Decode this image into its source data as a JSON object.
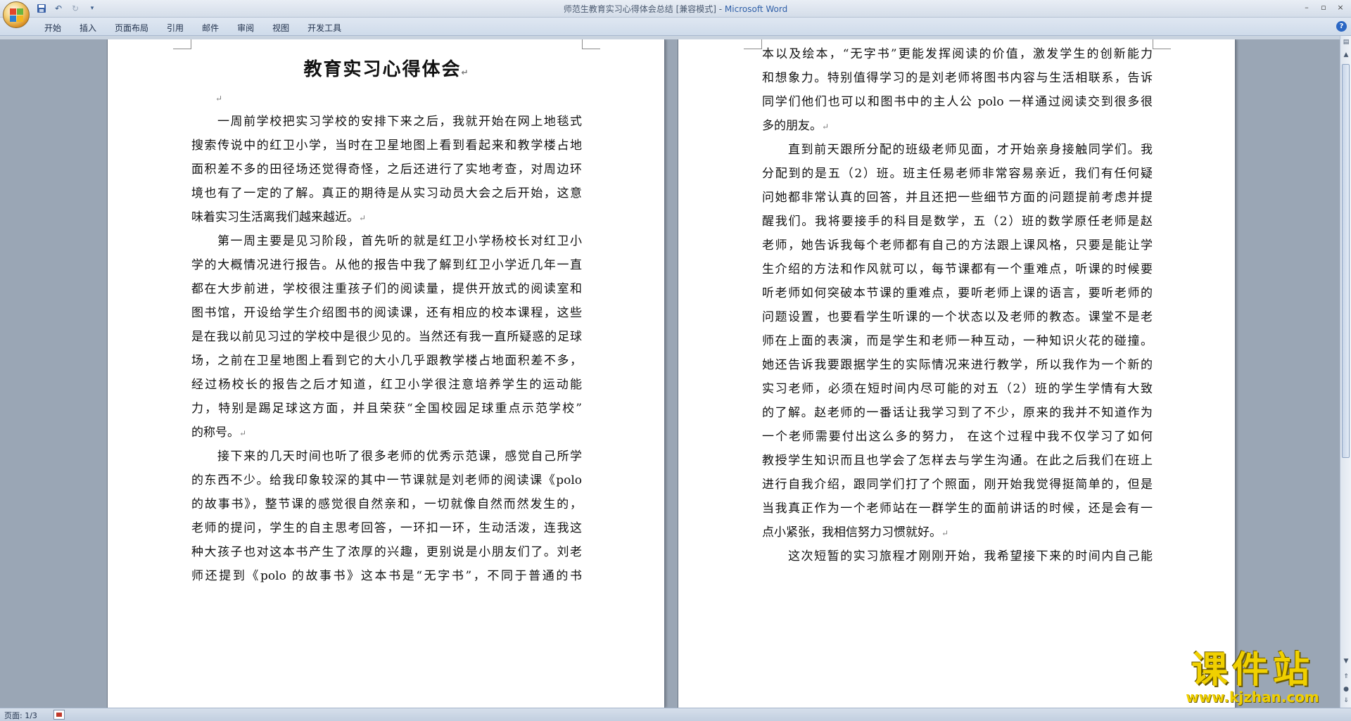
{
  "window": {
    "title": "师范生教育实习心得体会总结 [兼容模式] - ",
    "app_name": "Microsoft Word",
    "controls": [
      "–",
      "▫",
      "×"
    ]
  },
  "qat": {
    "save_icon": "save-icon",
    "undo_icon": "undo-icon",
    "redo_icon": "redo-icon",
    "customize_icon": "customize-icon"
  },
  "ribbon": {
    "tabs": [
      "开始",
      "插入",
      "页面布局",
      "引用",
      "邮件",
      "审阅",
      "视图",
      "开发工具"
    ]
  },
  "document": {
    "title": "教育实习心得体会",
    "para_mark": "↵",
    "page1_lines": [
      {
        "text": "一周前学校把实习学校的安排下来之后，我就开始在网上地毯式",
        "indent": true
      },
      {
        "text": "搜索传说中的红卫小学，当时在卫星地图上看到看起来和教学楼占地"
      },
      {
        "text": "面积差不多的田径场还觉得奇怪，之后还进行了实地考查，对周边环"
      },
      {
        "text": "境也有了一定的了解。真正的期待是从实习动员大会之后开始，这意"
      },
      {
        "text": "味着实习生活离我们越来越近。",
        "last": true
      },
      {
        "text": "第一周主要是见习阶段，首先听的就是红卫小学杨校长对红卫小",
        "indent": true
      },
      {
        "text": "学的大概情况进行报告。从他的报告中我了解到红卫小学近几年一直"
      },
      {
        "text": "都在大步前进，学校很注重孩子们的阅读量，提供开放式的阅读室和"
      },
      {
        "text": "图书馆，开设给学生介绍图书的阅读课，还有相应的校本课程，这些"
      },
      {
        "text": "是在我以前见习过的学校中是很少见的。当然还有我一直所疑惑的足球"
      },
      {
        "text": "场，之前在卫星地图上看到它的大小几乎跟教学楼占地面积差不多，"
      },
      {
        "text": "经过杨校长的报告之后才知道，红卫小学很注意培养学生的运动能"
      },
      {
        "text": "力，特别是踢足球这方面，并且荣获“全国校园足球重点示范学校”"
      },
      {
        "text": "的称号。",
        "last": true
      },
      {
        "text": "接下来的几天时间也听了很多老师的优秀示范课，感觉自己所学",
        "indent": true
      },
      {
        "text": "的东西不少。给我印象较深的其中一节课就是刘老师的阅读课《polo"
      },
      {
        "text": "的故事书》，整节课的感觉很自然亲和，一切就像自然而然发生的，"
      },
      {
        "text": "老师的提问，学生的自主思考回答，一环扣一环，生动活泼，连我这"
      },
      {
        "text": "种大孩子也对这本书产生了浓厚的兴趣，更别说是小朋友们了。刘老"
      },
      {
        "text": "师还提到《polo 的故事书》这本书是“无字书”，不同于普通的书"
      }
    ],
    "page2_lines": [
      {
        "text": "本以及绘本，“无字书”更能发挥阅读的价值，激发学生的创新能力"
      },
      {
        "text": "和想象力。特别值得学习的是刘老师将图书内容与生活相联系，告诉"
      },
      {
        "text": "同学们他们也可以和图书中的主人公 polo 一样通过阅读交到很多很"
      },
      {
        "text": "多的朋友。",
        "last": true
      },
      {
        "text": "直到前天跟所分配的班级老师见面，才开始亲身接触同学们。我",
        "indent": true
      },
      {
        "text": "分配到的是五（2）班。班主任易老师非常容易亲近，我们有任何疑"
      },
      {
        "text": "问她都非常认真的回答，并且还把一些细节方面的问题提前考虑并提"
      },
      {
        "text": "醒我们。我将要接手的科目是数学，五（2）班的数学原任老师是赵"
      },
      {
        "text": "老师，她告诉我每个老师都有自己的方法跟上课风格，只要是能让学"
      },
      {
        "text": "生介绍的方法和作风就可以，每节课都有一个重难点，听课的时候要"
      },
      {
        "text": "听老师如何突破本节课的重难点，要听老师上课的语言，要听老师的"
      },
      {
        "text": "问题设置，也要看学生听课的一个状态以及老师的教态。课堂不是老"
      },
      {
        "text": "师在上面的表演，而是学生和老师一种互动，一种知识火花的碰撞。"
      },
      {
        "text": "她还告诉我要跟据学生的实际情况来进行教学，所以我作为一个新的"
      },
      {
        "text": "实习老师，必须在短时间内尽可能的对五（2）班的学生学情有大致"
      },
      {
        "text": "的了解。赵老师的一番话让我学习到了不少，原来的我并不知道作为"
      },
      {
        "text": "一个老师需要付出这么多的努力，  在这个过程中我不仅学习了如何"
      },
      {
        "text": "教授学生知识而且也学会了怎样去与学生沟通。在此之后我们在班上"
      },
      {
        "text": "进行自我介绍，跟同学们打了个照面，刚开始我觉得挺简单的，但是"
      },
      {
        "text": "当我真正作为一个老师站在一群学生的面前讲话的时候，还是会有一"
      },
      {
        "text": "点小紧张，我相信努力习惯就好。",
        "last": true
      },
      {
        "text": "这次短暂的实习旅程才刚刚开始，我希望接下来的时间内自己能",
        "indent": true
      }
    ]
  },
  "statusbar": {
    "page_info": "页面: 1/3"
  },
  "watermark": {
    "main": "课件站",
    "url": "www.kjzhan.com"
  }
}
